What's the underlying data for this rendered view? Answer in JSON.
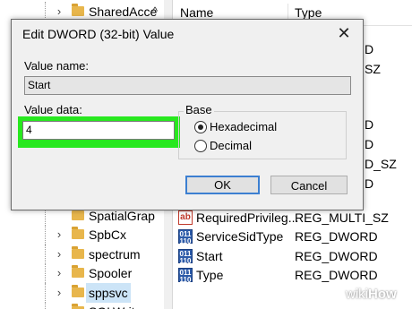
{
  "tree": {
    "items": [
      {
        "label": "SharedAcce"
      },
      {
        "label": "SpatialGrap"
      },
      {
        "label": "SpbCx"
      },
      {
        "label": "spectrum"
      },
      {
        "label": "Spooler"
      },
      {
        "label": "sppsvc"
      },
      {
        "label": "SQLWriter"
      }
    ],
    "scroll_up": "^"
  },
  "list": {
    "header_name": "Name",
    "header_type": "Type",
    "peek_types": [
      "D",
      "SZ",
      "D",
      "D",
      "Y",
      "D_SZ",
      "D",
      "D"
    ],
    "rows": [
      {
        "icon": "ab",
        "name": "RequiredPrivileg...",
        "type": "REG_MULTI_SZ"
      },
      {
        "icon": "bin",
        "name": "ServiceSidType",
        "type": "REG_DWORD"
      },
      {
        "icon": "bin",
        "name": "Start",
        "type": "REG_DWORD"
      },
      {
        "icon": "bin",
        "name": "Type",
        "type": "REG_DWORD"
      }
    ]
  },
  "dialog": {
    "title": "Edit DWORD (32-bit) Value",
    "close": "✕",
    "value_name_label": "Value name:",
    "value_name": "Start",
    "value_data_label": "Value data:",
    "value_data": "4",
    "base_label": "Base",
    "hex_label": "Hexadecimal",
    "dec_label": "Decimal",
    "ok": "OK",
    "cancel": "Cancel",
    "highlight_color": "#28e81f"
  },
  "watermark": {
    "wiki": "wiki",
    "how": "How"
  }
}
